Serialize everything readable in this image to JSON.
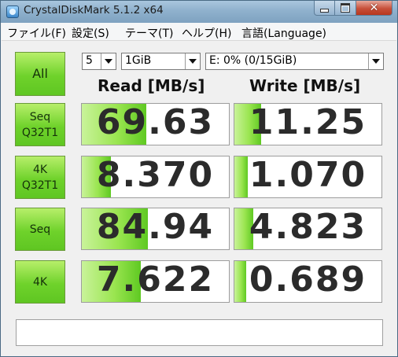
{
  "window": {
    "title": "CrystalDiskMark 5.1.2 x64"
  },
  "menu": [
    "ファイル(F)",
    "設定(S)",
    "テーマ(T)",
    "ヘルプ(H)",
    "言語(Language)"
  ],
  "controls": {
    "count": "5",
    "size": "1GiB",
    "drive": "E: 0% (0/15GiB)"
  },
  "buttons": {
    "all": "All",
    "seq_q32t1": "Seq\nQ32T1",
    "k4_q32t1": "4K\nQ32T1",
    "seq": "Seq",
    "k4": "4K"
  },
  "headers": {
    "read": "Read [MB/s]",
    "write": "Write [MB/s]"
  },
  "results": [
    {
      "read": "69.63",
      "write": "11.25",
      "read_level": 0.44,
      "write_level": 0.18
    },
    {
      "read": "8.370",
      "write": "1.070",
      "read_level": 0.2,
      "write_level": 0.09
    },
    {
      "read": "84.94",
      "write": "4.823",
      "read_level": 0.45,
      "write_level": 0.13
    },
    {
      "read": "7.622",
      "write": "0.689",
      "read_level": 0.4,
      "write_level": 0.08
    }
  ],
  "comment": ""
}
